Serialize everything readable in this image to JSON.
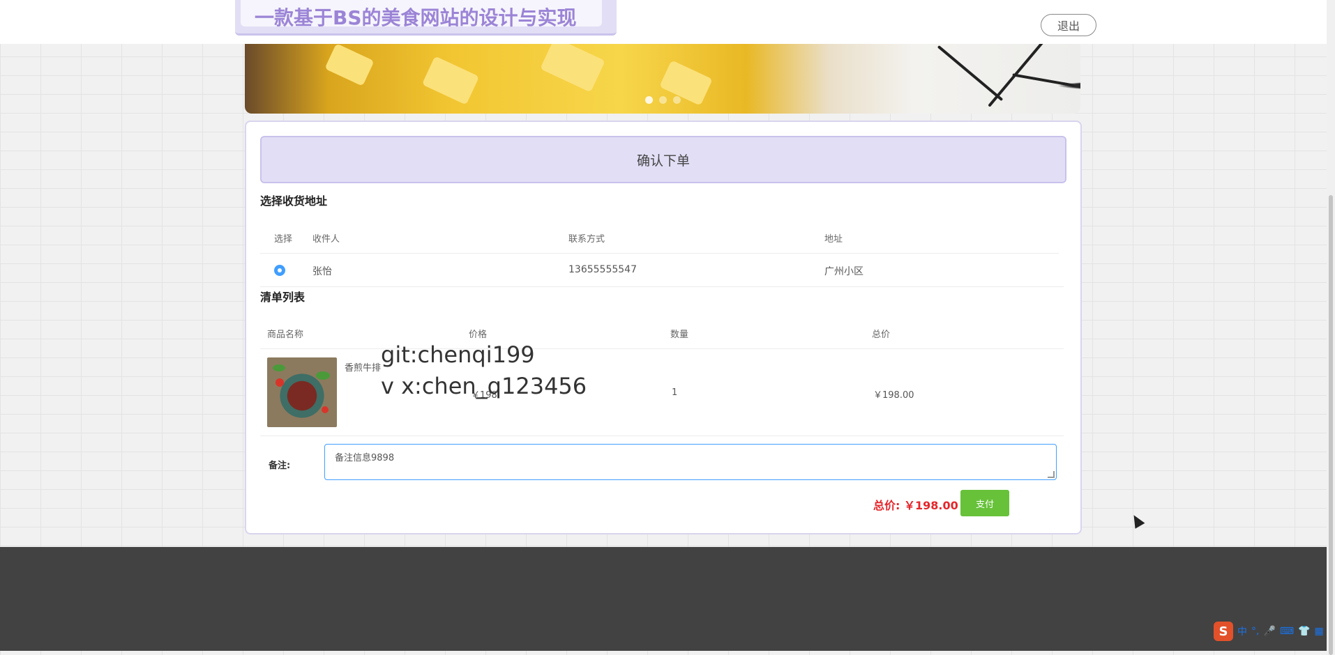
{
  "header": {
    "site_title": "一款基于BS的美食网站的设计与实现",
    "logout_label": "退出"
  },
  "order": {
    "confirm_title": "确认下单",
    "address_section": {
      "title": "选择收货地址",
      "columns": [
        "选择",
        "收件人",
        "联系方式",
        "地址"
      ],
      "rows": [
        {
          "selected": true,
          "recipient": "张怡",
          "phone": "13655555547",
          "address": "广州小区"
        }
      ]
    },
    "items_section": {
      "title": "清单列表",
      "columns": [
        "商品名称",
        "价格",
        "数量",
        "总价"
      ],
      "rows": [
        {
          "name": "香煎牛排",
          "price": "￥198",
          "quantity": "1",
          "total": "￥198.00"
        }
      ]
    },
    "remark_label": "备注:",
    "remark_value": "备注信息9898",
    "total_label": "总价: ￥198.00",
    "pay_label": "支付"
  },
  "watermark": {
    "line1": "git:chenqi199",
    "line2": "v x:chen_q123456"
  },
  "ime": {
    "logo": "S",
    "mode": "中"
  },
  "colors": {
    "accent_purple": "#9b84d6",
    "pay_green": "#67c23a",
    "price_red": "#e4262b",
    "radio_blue": "#409eff"
  }
}
